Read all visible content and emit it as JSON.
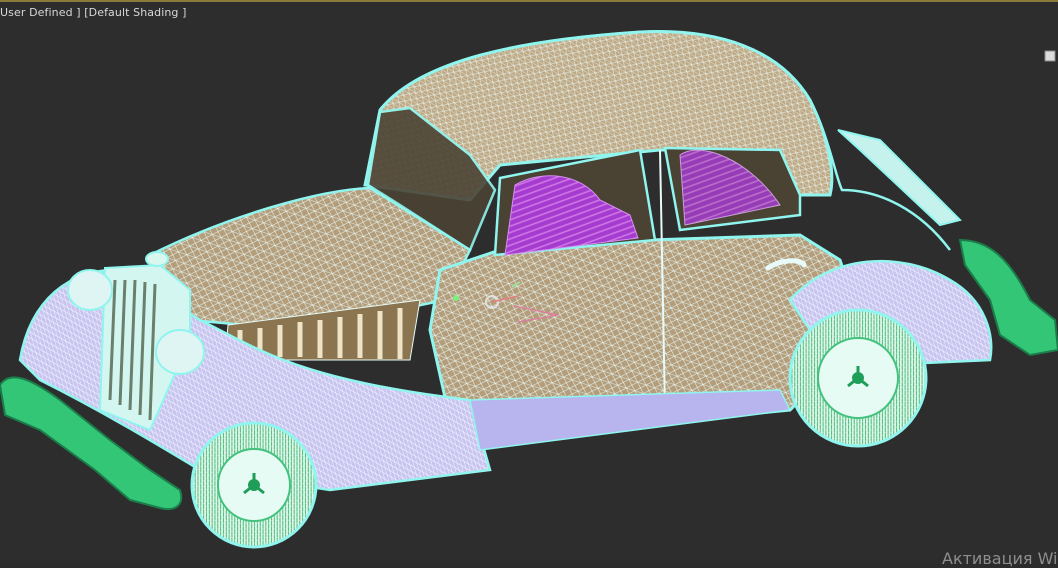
{
  "viewport": {
    "label_part1": "User Defined",
    "label_part2": "[Default Shading",
    "label_full": "User Defined ] [Default Shading ]",
    "background": "#2d2d2d",
    "active_border_color": "#8a7a3a"
  },
  "model": {
    "object": "vintage-car-wireframe",
    "wire_color": "#9ff0ec",
    "body_color": "#b8a07c",
    "fender_color": "#c9c7f2",
    "tire_color": "#2fbf6f",
    "seat_color": "#a040c8"
  },
  "watermark": {
    "text": "Активация Wi"
  },
  "icons": {
    "viewcube_corner": "viewcube-corner-icon",
    "transform_gizmo": "transform-gizmo-icon"
  }
}
